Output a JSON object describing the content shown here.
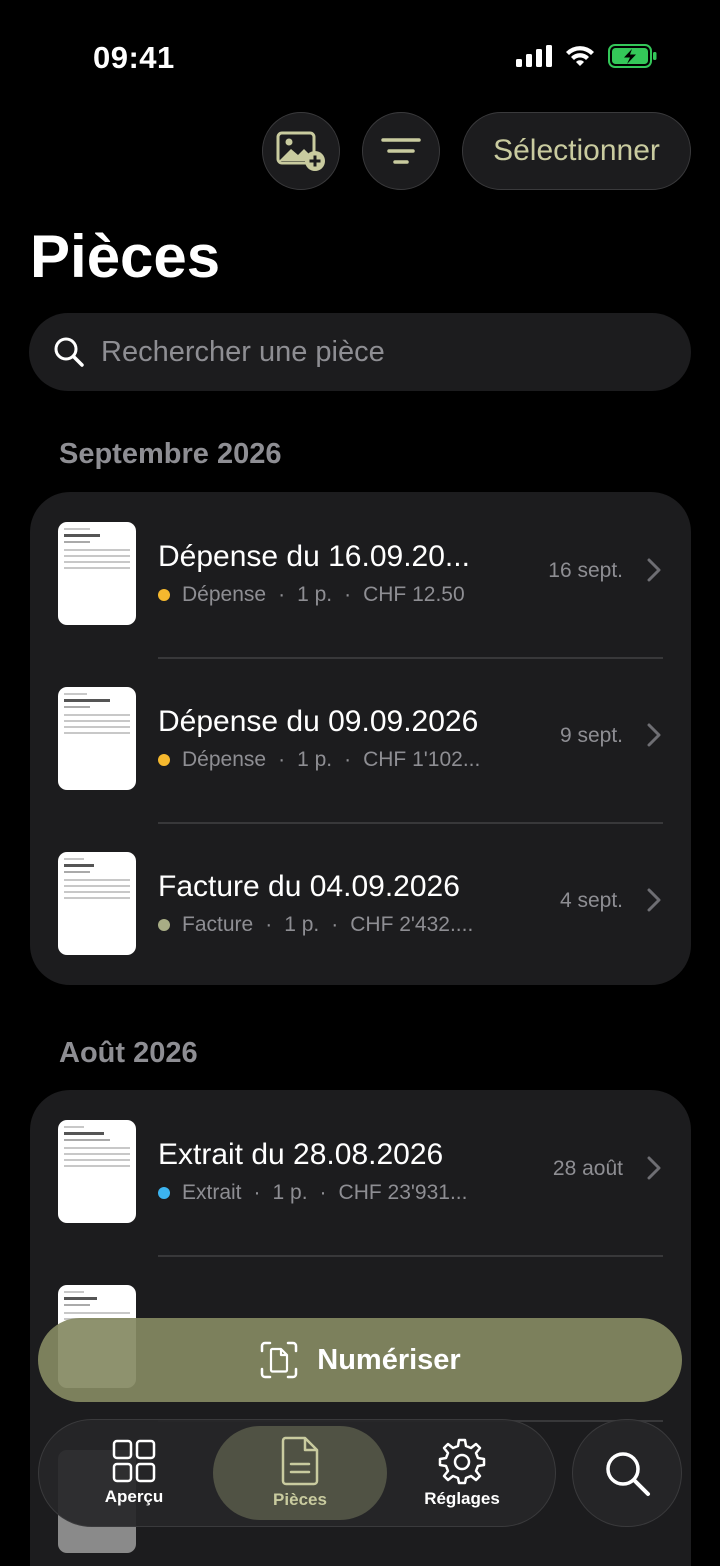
{
  "status": {
    "time": "09:41"
  },
  "toolbar": {
    "select_label": "Sélectionner"
  },
  "page": {
    "title": "Pièces"
  },
  "search": {
    "placeholder": "Rechercher une pièce"
  },
  "sections": [
    {
      "title": "Septembre 2026",
      "items": [
        {
          "title": "Dépense du 16.09.20...",
          "type": "Dépense",
          "type_color": "#f5b82e",
          "pages": "1 p.",
          "amount": "CHF 12.50",
          "date": "16 sept."
        },
        {
          "title": "Dépense du 09.09.2026",
          "type": "Dépense",
          "type_color": "#f5b82e",
          "pages": "1 p.",
          "amount": "CHF 1'102...",
          "date": "9 sept."
        },
        {
          "title": "Facture du 04.09.2026",
          "type": "Facture",
          "type_color": "#a8ad85",
          "pages": "1 p.",
          "amount": "CHF 2'432....",
          "date": "4 sept."
        }
      ]
    },
    {
      "title": "Août 2026",
      "items": [
        {
          "title": "Extrait du 28.08.2026",
          "type": "Extrait",
          "type_color": "#3cb4f0",
          "pages": "1 p.",
          "amount": "CHF 23'931...",
          "date": "28 août"
        }
      ]
    }
  ],
  "scan_button": {
    "label": "Numériser"
  },
  "tabs": [
    {
      "label": "Aperçu"
    },
    {
      "label": "Pièces"
    },
    {
      "label": "Réglages"
    }
  ],
  "colors": {
    "accent": "#c9cb9f",
    "scan_bg": "#848962"
  }
}
